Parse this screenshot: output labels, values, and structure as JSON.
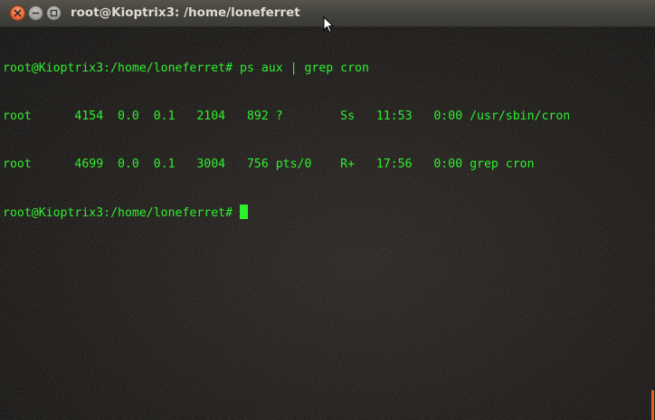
{
  "window": {
    "title": "root@Kioptrix3: /home/loneferret",
    "buttons": {
      "close_icon": "close-icon",
      "minimize_icon": "minimize-icon",
      "maximize_icon": "maximize-icon"
    }
  },
  "terminal": {
    "text_color": "#2ef02e",
    "lines": [
      "root@Kioptrix3:/home/loneferret# ps aux | grep cron",
      "root      4154  0.0  0.1   2104   892 ?        Ss   11:53   0:00 /usr/sbin/cron",
      "root      4699  0.0  0.1   3004   756 pts/0    R+   17:56   0:00 grep cron"
    ],
    "prompt": "root@Kioptrix3:/home/loneferret# "
  }
}
